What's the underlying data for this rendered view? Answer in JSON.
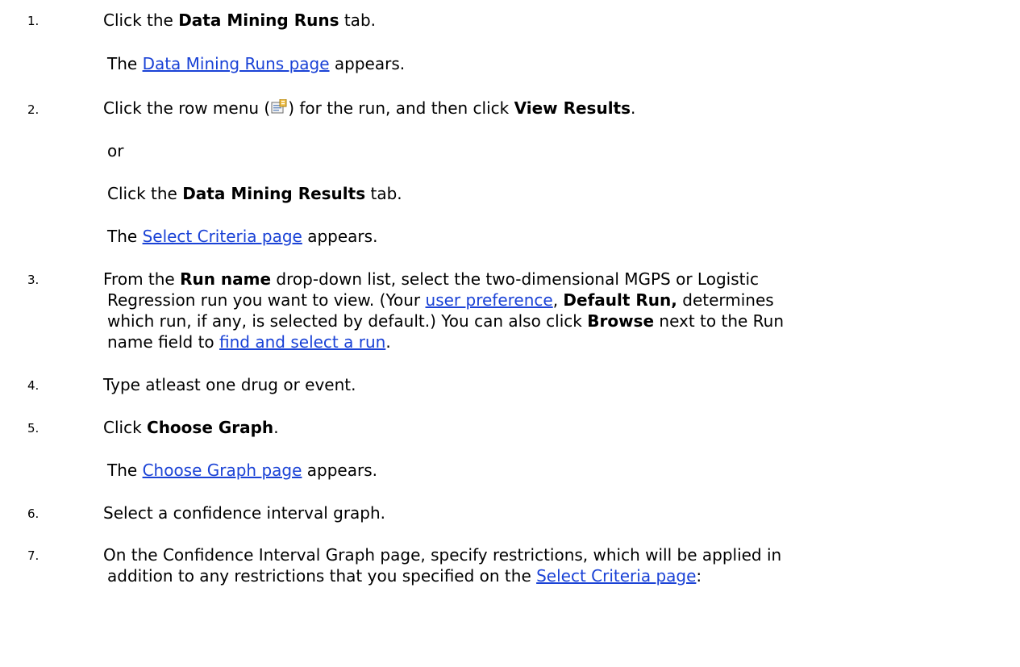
{
  "steps": [
    {
      "number": "1.",
      "text_a": "Click the ",
      "bold_a": "Data Mining Runs",
      "text_b": " tab.",
      "result_pre": "The ",
      "result_link": "Data Mining Runs page",
      "result_post": " appears."
    },
    {
      "number": "2.",
      "text_a": "Click the row menu (",
      "icon": "row-menu-icon",
      "text_b": ") for the run, and then click ",
      "bold_a": "View Results",
      "text_c": ".",
      "or": "or",
      "alt_a": "Click the ",
      "alt_bold": "Data Mining Results",
      "alt_b": " tab.",
      "result_pre": "The ",
      "result_link": "Select Criteria page",
      "result_post": " appears."
    },
    {
      "number": "3.",
      "l1_a": "From the ",
      "l1_bold": "Run name",
      "l1_b": " drop-down list, select the two-dimensional MGPS or Logistic",
      "l2_a": "Regression run you want to view. (Your ",
      "l2_link": "user preference",
      "l2_b": ", ",
      "l2_bold": "Default Run,",
      "l2_c": " determines",
      "l3_a": "which run, if any, is selected by default.) You can also click ",
      "l3_bold": "Browse",
      "l3_b": " next to the Run",
      "l4_a": "name field to ",
      "l4_link": "find and select a run",
      "l4_b": "."
    },
    {
      "number": "4.",
      "text": "Type atleast one drug or event."
    },
    {
      "number": "5.",
      "text_a": "Click ",
      "bold_a": "Choose Graph",
      "text_b": ".",
      "result_pre": "The ",
      "result_link": "Choose Graph page",
      "result_post": " appears."
    },
    {
      "number": "6.",
      "text": "Select a confidence interval graph."
    },
    {
      "number": "7.",
      "l1": "On the Confidence Interval Graph page, specify restrictions, which will be applied in",
      "l2_a": "addition to any restrictions that you specified on the ",
      "l2_link": "Select Criteria page",
      "l2_b": ":"
    }
  ],
  "colors": {
    "link": "#1a42d6",
    "text": "#000000"
  }
}
